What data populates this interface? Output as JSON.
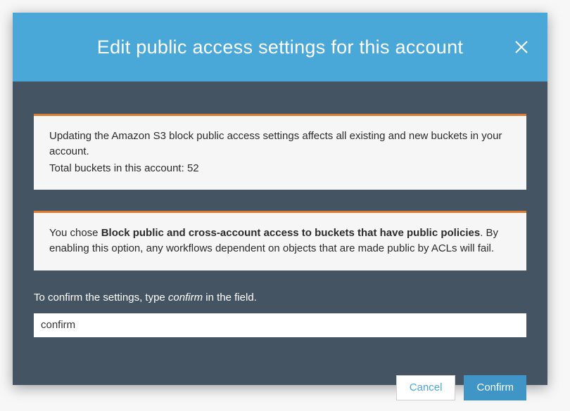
{
  "modal": {
    "title": "Edit public access settings for this account",
    "box1": {
      "line1": "Updating the Amazon S3 block public access settings affects all existing and new buckets in your account.",
      "line2_prefix": "Total buckets in this account: ",
      "bucket_count": "52"
    },
    "box2": {
      "prefix": "You chose ",
      "bold": "Block public and cross-account access to buckets that have public policies",
      "suffix": ". By enabling this option, any workflows dependent on objects that are made public by ACLs will fail."
    },
    "confirm_label_prefix": "To confirm the settings, type ",
    "confirm_label_italic": "confirm",
    "confirm_label_suffix": " in the field.",
    "input_value": "confirm",
    "buttons": {
      "cancel": "Cancel",
      "confirm": "Confirm"
    }
  }
}
